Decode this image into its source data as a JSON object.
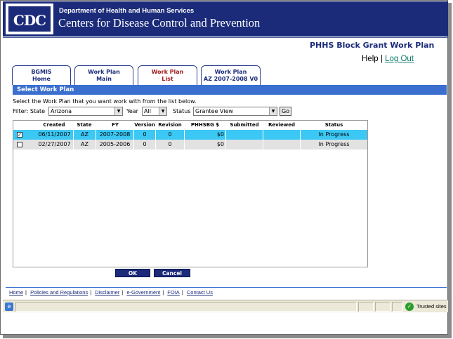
{
  "header": {
    "logo_text": "CDC",
    "department": "Department of Health and Human Services",
    "center": "Centers for Disease Control and Prevention",
    "app_title": "PHHS Block Grant Work Plan",
    "help_label": "Help",
    "separator": "|",
    "logout_label": "Log Out"
  },
  "tabs": [
    {
      "line1": "BGMIS",
      "line2": "Home"
    },
    {
      "line1": "Work Plan",
      "line2": "Main"
    },
    {
      "line1": "Work Plan",
      "line2": "List"
    },
    {
      "line1": "Work Plan",
      "line2": "AZ 2007-2008 V0"
    }
  ],
  "section_title": "Select Work Plan",
  "instruction": "Select the Work Plan that you want work with from the list below.",
  "filter": {
    "filter_label": "Filter: State",
    "state_value": "Arizona",
    "year_label": "Year",
    "year_value": "All",
    "status_label": "Status",
    "status_value": "Grantee View",
    "go_label": "Go"
  },
  "table": {
    "columns": [
      "Created",
      "State",
      "FY",
      "Version",
      "Revision",
      "PHHSBG $",
      "Submitted",
      "Reviewed",
      "Status"
    ],
    "rows": [
      {
        "checked": true,
        "created": "06/11/2007",
        "state": "AZ",
        "fy": "2007-2008",
        "version": "0",
        "revision": "0",
        "amount": "$0",
        "submitted": "",
        "reviewed": "",
        "status": "In Progress"
      },
      {
        "checked": false,
        "created": "02/27/2007",
        "state": "AZ",
        "fy": "2005-2006",
        "version": "0",
        "revision": "0",
        "amount": "$0",
        "submitted": "",
        "reviewed": "",
        "status": "In Progress"
      }
    ]
  },
  "buttons": {
    "ok": "OK",
    "cancel": "Cancel"
  },
  "footer_links": [
    "Home",
    "Policies and Regulations",
    "Disclaimer",
    "e-Government",
    "FOIA",
    "Contact Us"
  ],
  "statusbar": {
    "zone": "Trusted sites"
  },
  "colors": {
    "banner": "#1b2b7a",
    "section_bar": "#3a6fd0",
    "selected_row": "#3cc8f4",
    "active_tab_text": "#a02020"
  }
}
